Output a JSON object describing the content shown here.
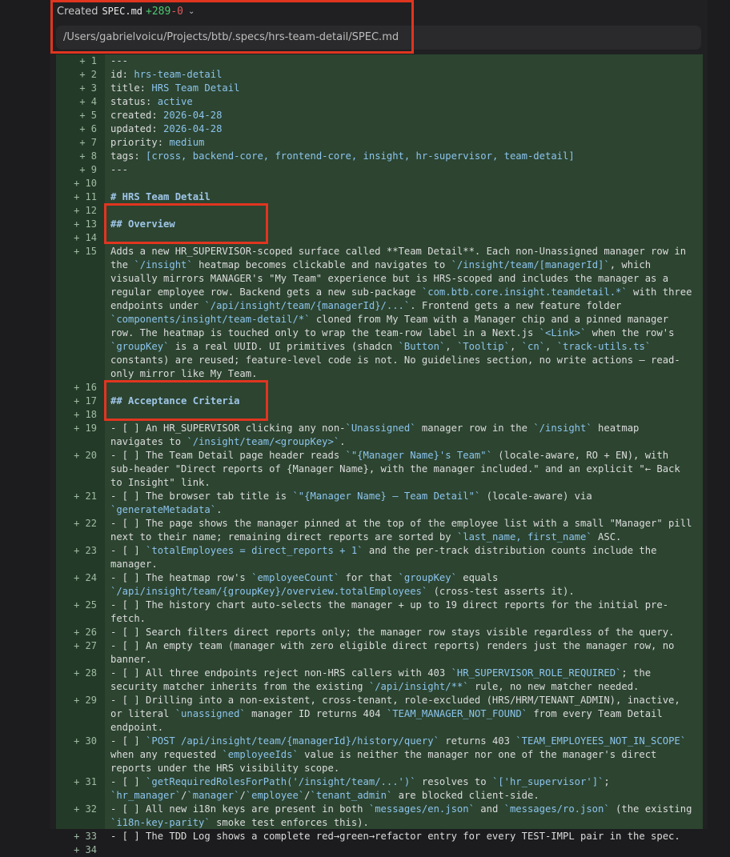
{
  "header": {
    "created_label": "Created",
    "file_name": "SPEC.md",
    "additions": "+289",
    "deletions": "-0",
    "chevron_icon": "chevron-down-icon"
  },
  "path": "/Users/gabrielvoicu/Projects/btb/.specs/hrs-team-detail/SPEC.md",
  "colors": {
    "diff_bg": "#2c4430",
    "gutter_bg": "#243a28",
    "highlight_box": "#e0351f",
    "additions": "#4ec970",
    "deletions": "#e05a5a",
    "code_ident": "#8cc4ec"
  },
  "lines": [
    {
      "n": "+ 1",
      "t": "---"
    },
    {
      "n": "+ 2",
      "t": "id: hrs-team-detail"
    },
    {
      "n": "+ 3",
      "t": "title: HRS Team Detail"
    },
    {
      "n": "+ 4",
      "t": "status: active"
    },
    {
      "n": "+ 5",
      "t": "created: 2026-04-28"
    },
    {
      "n": "+ 6",
      "t": "updated: 2026-04-28"
    },
    {
      "n": "+ 7",
      "t": "priority: medium"
    },
    {
      "n": "+ 8",
      "t": "tags: [cross, backend-core, frontend-core, insight, hr-supervisor, team-detail]"
    },
    {
      "n": "+ 9",
      "t": "---"
    },
    {
      "n": "+ 10",
      "t": ""
    },
    {
      "n": "+ 11",
      "t": "# HRS Team Detail",
      "h": true
    },
    {
      "n": "+ 12",
      "t": ""
    },
    {
      "n": "+ 13",
      "t": "## Overview",
      "h": true
    },
    {
      "n": "+ 14",
      "t": ""
    },
    {
      "n": "+ 15",
      "t": "Adds a new HR_SUPERVISOR-scoped surface called **Team Detail**. Each non-Unassigned manager row in the `/insight` heatmap becomes clickable and navigates to `/insight/team/[managerId]`, which visually mirrors MANAGER's \"My Team\" experience but is HRS-scoped and includes the manager as a regular employee row. Backend gets a new sub-package `com.btb.core.insight.teamdetail.*` with three endpoints under `/api/insight/team/{managerId}/...`. Frontend gets a new feature folder `components/insight/team-detail/*` cloned from My Team with a Manager chip and a pinned manager row. The heatmap is touched only to wrap the team-row label in a Next.js `<Link>` when the row's `groupKey` is a real UUID. UI primitives (shadcn `Button`, `Tooltip`, `cn`, `track-utils.ts` constants) are reused; feature-level code is not. No guidelines section, no write actions — read-only mirror like My Team."
    },
    {
      "n": "+ 16",
      "t": ""
    },
    {
      "n": "+ 17",
      "t": "## Acceptance Criteria",
      "h": true
    },
    {
      "n": "+ 18",
      "t": ""
    },
    {
      "n": "+ 19",
      "t": "- [ ] An HR_SUPERVISOR clicking any non-`Unassigned` manager row in the `/insight` heatmap navigates to `/insight/team/<groupKey>`."
    },
    {
      "n": "+ 20",
      "t": "- [ ] The Team Detail page header reads `\"{Manager Name}'s Team\"` (locale-aware, RO + EN), with sub-header \"Direct reports of {Manager Name}, with the manager included.\" and an explicit \"← Back to Insight\" link."
    },
    {
      "n": "+ 21",
      "t": "- [ ] The browser tab title is `\"{Manager Name} — Team Detail\"` (locale-aware) via `generateMetadata`."
    },
    {
      "n": "+ 22",
      "t": "- [ ] The page shows the manager pinned at the top of the employee list with a small \"Manager\" pill next to their name; remaining direct reports are sorted by `last_name, first_name` ASC."
    },
    {
      "n": "+ 23",
      "t": "- [ ] `totalEmployees = direct_reports + 1` and the per-track distribution counts include the manager."
    },
    {
      "n": "+ 24",
      "t": "- [ ] The heatmap row's `employeeCount` for that `groupKey` equals `/api/insight/team/{groupKey}/overview.totalEmployees` (cross-test asserts it)."
    },
    {
      "n": "+ 25",
      "t": "- [ ] The history chart auto-selects the manager + up to 19 direct reports for the initial pre-fetch."
    },
    {
      "n": "+ 26",
      "t": "- [ ] Search filters direct reports only; the manager row stays visible regardless of the query."
    },
    {
      "n": "+ 27",
      "t": "- [ ] An empty team (manager with zero eligible direct reports) renders just the manager row, no banner."
    },
    {
      "n": "+ 28",
      "t": "- [ ] All three endpoints reject non-HRS callers with 403 `HR_SUPERVISOR_ROLE_REQUIRED`; the security matcher inherits from the existing `/api/insight/**` rule, no new matcher needed."
    },
    {
      "n": "+ 29",
      "t": "- [ ] Drilling into a non-existent, cross-tenant, role-excluded (HRS/HRM/TENANT_ADMIN), inactive, or literal `unassigned` manager ID returns 404 `TEAM_MANAGER_NOT_FOUND` from every Team Detail endpoint."
    },
    {
      "n": "+ 30",
      "t": "- [ ] `POST /api/insight/team/{managerId}/history/query` returns 403 `TEAM_EMPLOYEES_NOT_IN_SCOPE` when any requested `employeeIds` value is neither the manager nor one of the manager's direct reports under the HRS visibility scope."
    },
    {
      "n": "+ 31",
      "t": "- [ ] `getRequiredRolesForPath('/insight/team/...')` resolves to `['hr_supervisor']`; `hr_manager`/`manager`/`employee`/`tenant_admin` are blocked client-side."
    },
    {
      "n": "+ 32",
      "t": "- [ ] All new i18n keys are present in both `messages/en.json` and `messages/ro.json` (the existing `i18n-key-parity` smoke test enforces this)."
    },
    {
      "n": "+ 33",
      "t": "- [ ] The TDD Log shows a complete red→green→refactor entry for every TEST-IMPL pair in the spec."
    },
    {
      "n": "+ 34",
      "t": ""
    }
  ]
}
